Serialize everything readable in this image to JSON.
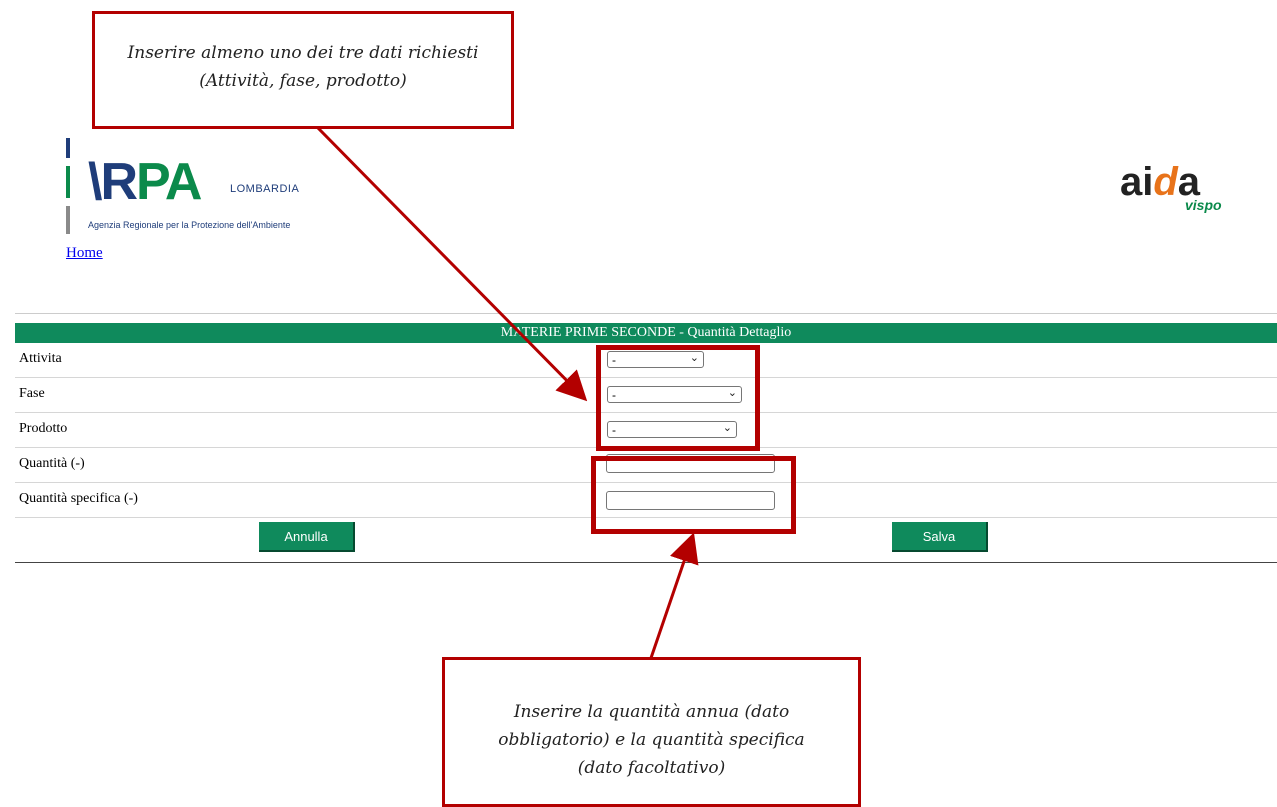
{
  "header": {
    "arpa_logo_word_left": "\\R",
    "arpa_logo_word_right": "PA",
    "arpa_logo_region": "LOMBARDIA",
    "arpa_logo_subtitle": "Agenzia Regionale per la Protezione dell'Ambiente",
    "aida_logo_a": "ai",
    "aida_logo_d": "d",
    "aida_logo_b": "a",
    "aida_logo_sub": "vispo",
    "home_link": "Home"
  },
  "form": {
    "title": "MATERIE PRIME SECONDE - Quantità Dettaglio",
    "fields": [
      {
        "label": "Attivita",
        "value": "-"
      },
      {
        "label": "Fase",
        "value": "-"
      },
      {
        "label": "Prodotto",
        "value": "-"
      },
      {
        "label": "Quantità (-)",
        "value": ""
      },
      {
        "label": "Quantità specifica (-)",
        "value": ""
      }
    ],
    "cancel_label": "Annulla",
    "save_label": "Salva"
  },
  "annotations": {
    "top_callout": "Inserire almeno uno dei tre dati richiesti (Attività, fase, prodotto)",
    "bottom_callout": "Inserire la quantità annua (dato obbligatorio) e la quantità specifica (dato facoltativo)"
  },
  "colors": {
    "header_green": "#0f8a5c",
    "annotation_red": "#b30000",
    "link_blue": "#0000ee"
  },
  "icons": [
    "chevron-down-icon"
  ]
}
